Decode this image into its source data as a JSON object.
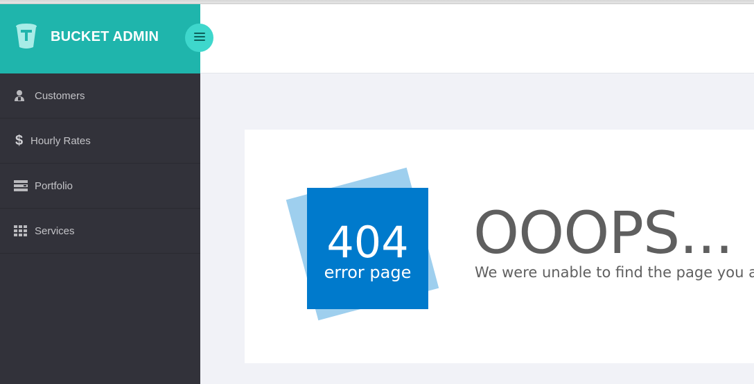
{
  "brand": {
    "title": "BUCKET ADMIN",
    "logo_icon": "bucket-icon",
    "toggle_icon": "hamburger-icon",
    "color": "#1fb5ac"
  },
  "sidebar": {
    "items": [
      {
        "label": "Customers",
        "icon": "user-icon"
      },
      {
        "label": "Hourly Rates",
        "icon": "dollar-icon"
      },
      {
        "label": "Portfolio",
        "icon": "server-icon"
      },
      {
        "label": "Services",
        "icon": "grid-icon"
      }
    ],
    "dollar_glyph": "$",
    "background": "#32323a"
  },
  "error": {
    "code": "404",
    "caption": "error page",
    "heading": "OOOPS...",
    "message": "We were unable to find the page you are looking for.",
    "tile_color": "#007acc",
    "tile_back_color": "#9ecfee"
  }
}
